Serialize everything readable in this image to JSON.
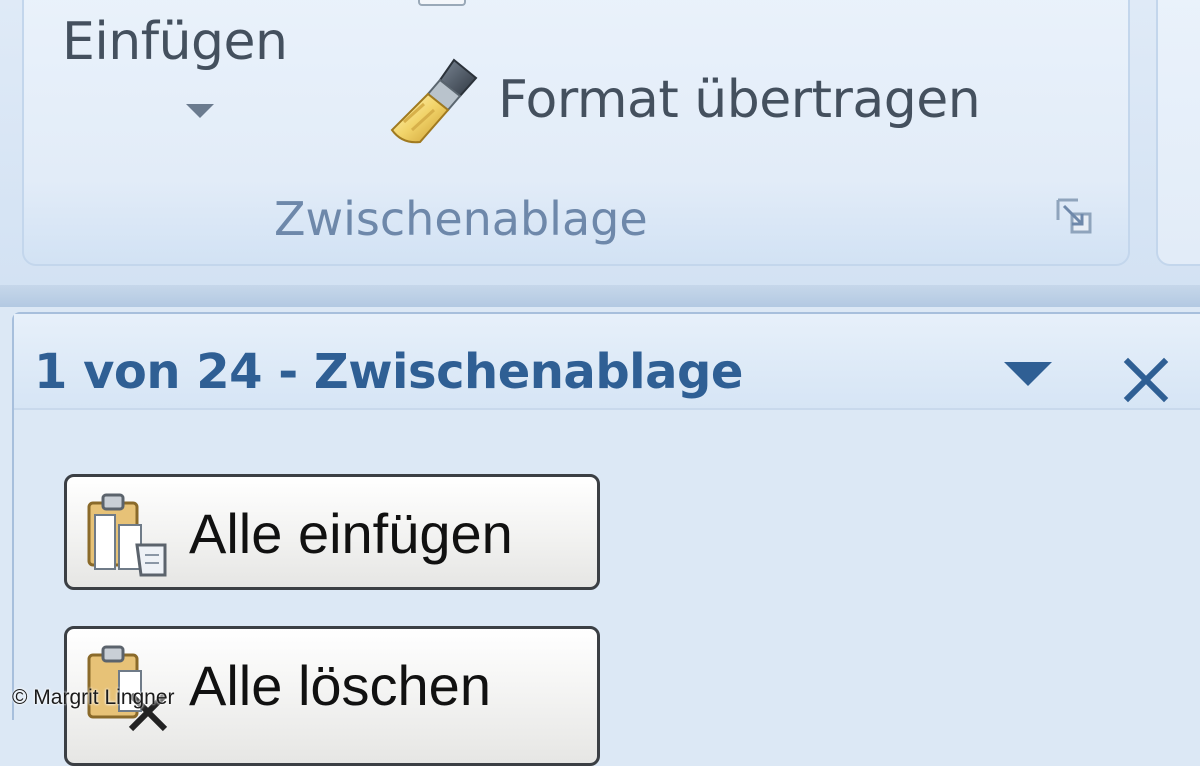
{
  "ribbon": {
    "paste_label": "Einfügen",
    "format_painter_label": "Format übertragen",
    "group_label": "Zwischenablage"
  },
  "task_pane": {
    "title": "1 von 24 - Zwischenablage",
    "buttons": {
      "paste_all": "Alle einfügen",
      "delete_all": "Alle löschen"
    }
  },
  "copyright": "© Margrit Lingner",
  "colors": {
    "pane_title": "#2f5f94",
    "ribbon_text": "#44505e",
    "group_label": "#6e88aa",
    "background": "#dce8f5"
  },
  "icons": {
    "paste_dropdown": "chevron-down-icon",
    "format_painter": "paintbrush-icon",
    "dialog_launcher": "dialog-launcher-icon",
    "pane_menu": "dropdown-triangle-icon",
    "pane_close": "close-icon",
    "paste_all": "clipboard-paste-icon",
    "delete_all": "clipboard-delete-icon"
  }
}
